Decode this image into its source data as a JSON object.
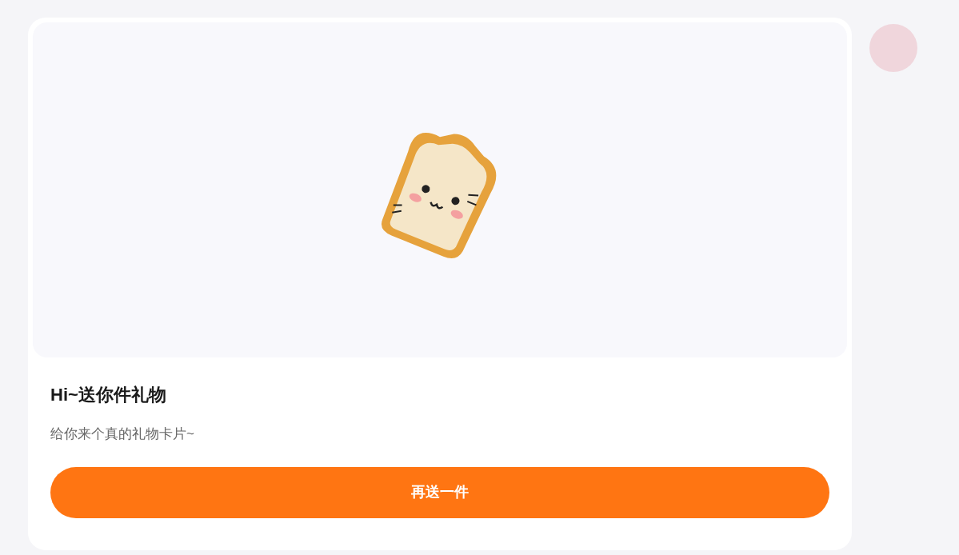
{
  "card": {
    "title": "Hi~送你件礼物",
    "description": "给你来个真的礼物卡片~",
    "button": "再送一件"
  }
}
